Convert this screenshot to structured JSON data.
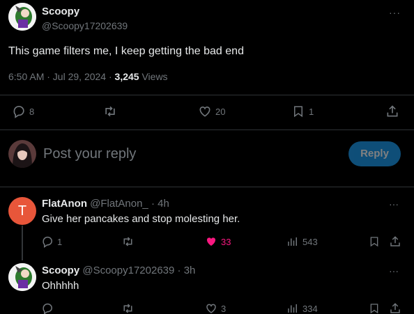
{
  "main_tweet": {
    "display_name": "Scoopy",
    "handle": "@Scoopy17202639",
    "text": "This game filters me, I keep getting the bad end",
    "time": "6:50 AM · Jul 29, 2024 · ",
    "views_count": "3,245",
    "views_label": " Views",
    "stats": {
      "replies": "8",
      "likes": "20",
      "bookmarks": "1"
    }
  },
  "compose": {
    "placeholder": "Post your reply",
    "reply_label": "Reply"
  },
  "replies": [
    {
      "display_name": "FlatAnon",
      "handle": "@FlatAnon_",
      "age": " · 4h",
      "avatar_letter": "T",
      "avatar_color": "#e8563a",
      "text": "Give her pancakes and stop molesting her.",
      "stats": {
        "replies": "1",
        "likes": "33",
        "views": "543"
      }
    },
    {
      "display_name": "Scoopy",
      "handle": "@Scoopy17202639",
      "age": " · 3h",
      "text": "Ohhhhh",
      "stats": {
        "likes": "3",
        "views": "334"
      }
    }
  ],
  "colors": {
    "accent": "#1d9bf0",
    "like_active": "#f91880",
    "muted": "#71767b"
  }
}
